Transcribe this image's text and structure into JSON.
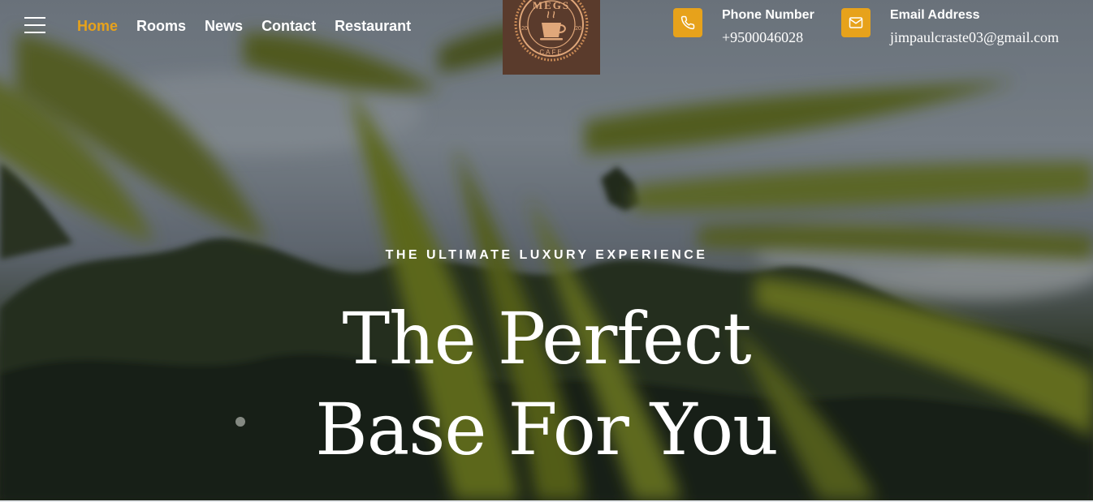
{
  "header": {
    "menu_icon": "hamburger-menu-icon",
    "nav": [
      {
        "label": "Home",
        "active": true
      },
      {
        "label": "Rooms",
        "active": false
      },
      {
        "label": "News",
        "active": false
      },
      {
        "label": "Contact",
        "active": false
      },
      {
        "label": "Restaurant",
        "active": false
      }
    ],
    "logo": {
      "top_text": "MEGS",
      "year_left": "20",
      "year_right": "20",
      "bottom_text": "CAFE",
      "icon": "coffee-cup-icon"
    },
    "phone": {
      "label": "Phone Number",
      "value": "+9500046028",
      "icon": "phone-icon"
    },
    "email": {
      "label": "Email Address",
      "value": "jimpaulcraste03@gmail.com",
      "icon": "envelope-icon"
    }
  },
  "hero": {
    "tagline": "THE ULTIMATE LUXURY EXPERIENCE",
    "headline_line1": "The Perfect",
    "headline_line2": "Base For You"
  },
  "colors": {
    "accent": "#e7a21b",
    "logo_bg": "#5a3b2c",
    "text": "#ffffff"
  }
}
